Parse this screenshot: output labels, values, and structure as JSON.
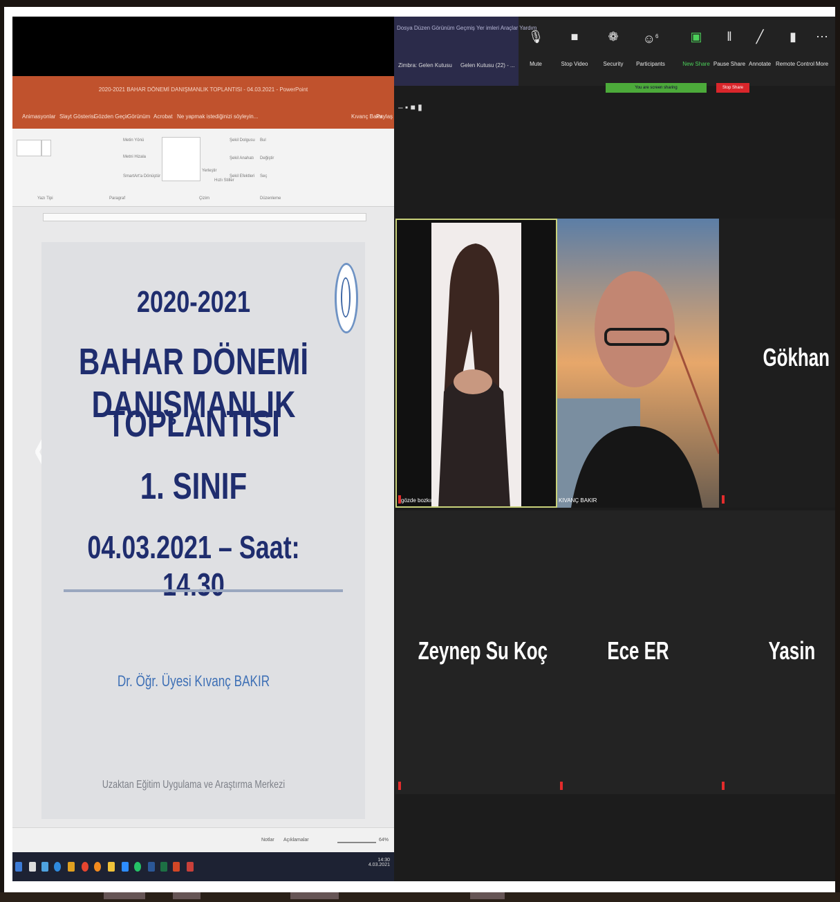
{
  "powerpoint": {
    "window_title": "2020-2021 BAHAR DÖNEMİ DANIŞMANLIK TOPLANTISI - 04.03.2021 - PowerPoint",
    "menu": [
      "Animasyonlar",
      "Slayt Gösterisi",
      "Gözden Geçir",
      "Görünüm",
      "Acrobat",
      "Ne yapmak istediğinizi söyleyin..."
    ],
    "menu_right": [
      "Kıvanç Bakır",
      "Paylaş"
    ],
    "ribbon": {
      "groups": [
        "Yazı Tipi",
        "Paragraf",
        "Çizim",
        "Düzenleme"
      ],
      "items": [
        "Metin Yönü",
        "Metni Hizala",
        "SmartArt'a Dönüştür",
        "Şekil Dolgusu",
        "Şekil Anahatı",
        "Şekil Efektleri",
        "Bul",
        "Değiştir",
        "Seç",
        "Yerleştir",
        "Hızlı Stiller"
      ]
    },
    "slide": {
      "line1": "2020-2021",
      "line2": "BAHAR DÖNEMİ DANIŞMANLIK",
      "line3": "TOPLANTISI",
      "line4": "1. SINIF",
      "line5": "04.03.2021 – Saat: 14.30",
      "presenter": "Dr. Öğr. Üyesi Kıvanç  BAKIR",
      "footer": "Uzaktan Eğitim Uygulama ve Araştırma Merkezi"
    },
    "statusbar": {
      "notes": "Notlar",
      "comments": "Açıklamalar",
      "zoom": "64%"
    },
    "taskbar_time": "14:30",
    "taskbar_date": "4.03.2021"
  },
  "zoom": {
    "browser_bookmarks": "Dosya  Düzen  Görünüm  Geçmiş  Yer imleri  Araçlar  Yardım",
    "browser_tabs": [
      "Zimbra: Gelen Kutusu",
      "Gelen Kutusu (22) - ..."
    ],
    "toolbar": [
      {
        "label": "Mute",
        "icon": "microphone-icon"
      },
      {
        "label": "Stop Video",
        "icon": "video-camera-icon"
      },
      {
        "label": "Security",
        "icon": "shield-icon"
      },
      {
        "label": "Participants",
        "icon": "participants-icon"
      },
      {
        "label": "New Share",
        "icon": "share-icon"
      },
      {
        "label": "Pause Share",
        "icon": "pause-icon"
      },
      {
        "label": "Annotate",
        "icon": "pen-icon"
      },
      {
        "label": "Remote Control",
        "icon": "mouse-icon"
      },
      {
        "label": "More",
        "icon": "more-icon"
      }
    ],
    "participant_count": "6",
    "share_banner": "You are screen sharing",
    "stop_share": "Stop Share",
    "participants": [
      {
        "name": "gözde bozkır",
        "video": true
      },
      {
        "name": "KIVANÇ BAKIR",
        "video": true
      },
      {
        "name": "Gökhan Memiş",
        "video": false
      },
      {
        "name": "Zeynep Su Koç",
        "video": false
      },
      {
        "name": "Ece ER",
        "video": false
      },
      {
        "name": "Yasin",
        "video": false
      }
    ],
    "colors": {
      "share_green": "#4caa3a",
      "stop_red": "#d9262b",
      "active_speaker": "#c9d27a"
    }
  }
}
